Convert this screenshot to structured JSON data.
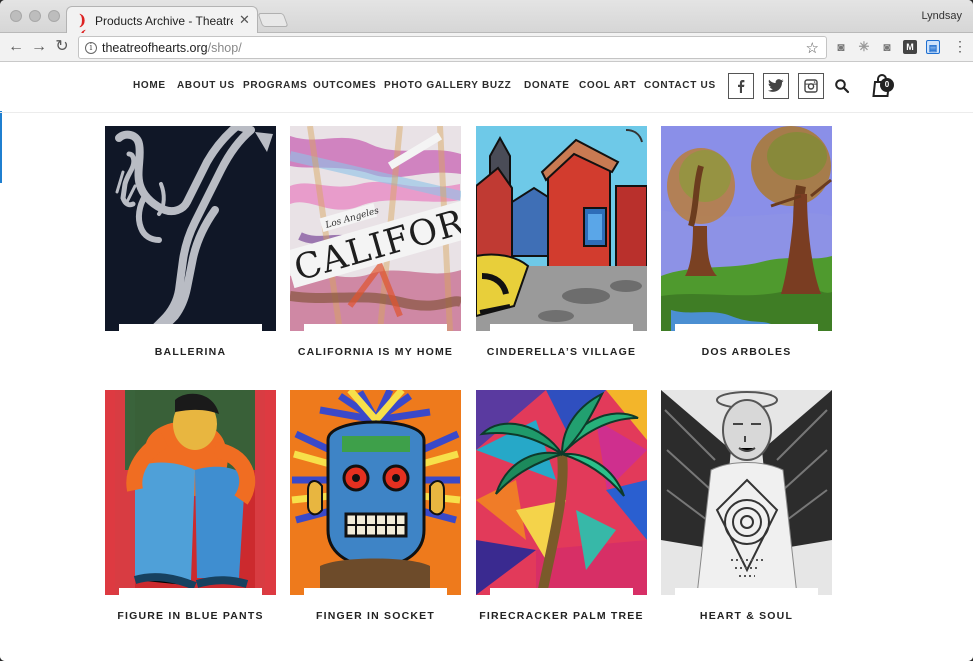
{
  "browser": {
    "tab_title": "Products Archive - Theatre of H",
    "url_host": "theatreofhearts.org",
    "url_path": "/shop/",
    "user": "Lyndsay"
  },
  "nav": {
    "items": [
      "HOME",
      "ABOUT US",
      "PROGRAMS",
      "OUTCOMES",
      "PHOTO GALLERY",
      "BUZZ",
      "DONATE",
      "COOL ART",
      "CONTACT US"
    ],
    "cart_count": "0"
  },
  "products": [
    {
      "name": "BALLERINA"
    },
    {
      "name": "CALIFORNIA IS MY HOME"
    },
    {
      "name": "CINDERELLA’S VILLAGE"
    },
    {
      "name": "DOS ARBOLES"
    },
    {
      "name": "FIGURE IN BLUE PANTS"
    },
    {
      "name": "FINGER IN SOCKET"
    },
    {
      "name": "FIRECRACKER PALM TREE"
    },
    {
      "name": "HEART & SOUL"
    }
  ],
  "art_text": {
    "california_word": "CALIFORNI",
    "california_sub": "Los Angeles"
  },
  "icons": [
    "facebook-icon",
    "twitter-icon",
    "instagram-icon",
    "search-icon",
    "shopping-bag-icon"
  ],
  "colors": {
    "accent": "#1f7fd0",
    "text": "#222222"
  }
}
